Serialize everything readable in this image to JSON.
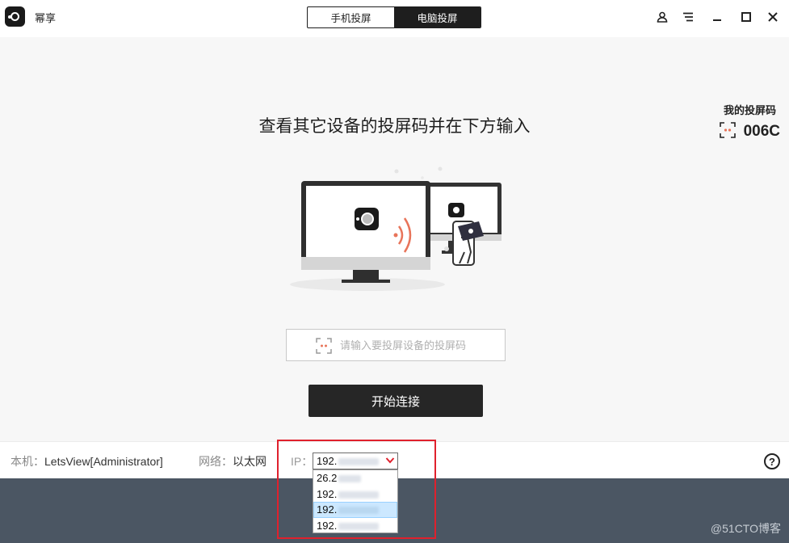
{
  "app": {
    "name": "幂享",
    "icon": "app-logo-icon"
  },
  "tabs": [
    {
      "label": "手机投屏",
      "active": false
    },
    {
      "label": "电脑投屏",
      "active": true
    }
  ],
  "window_controls": [
    "user-icon",
    "menu-icon",
    "minimize-icon",
    "maximize-icon",
    "close-icon"
  ],
  "my_code": {
    "label": "我的投屏码",
    "value": "006C"
  },
  "main": {
    "headline": "查看其它设备的投屏码并在下方输入",
    "input_placeholder": "请输入要投屏设备的投屏码",
    "connect_label": "开始连接"
  },
  "status": {
    "host_key": "本机：",
    "host_value": "LetsView[Administrator]",
    "net_key": "网络：",
    "net_value": "以太网",
    "ip_label": "IP：",
    "ip_selected": "192."
  },
  "ip_options": [
    "26.2",
    "192.",
    "192.",
    "192."
  ],
  "ip_selected_index": 2,
  "watermark": "@51CTO博客",
  "colors": {
    "accent": "#1e1e1e",
    "footer": "#4b5663",
    "highlight": "#e0212d",
    "wave": "#e8745a"
  }
}
